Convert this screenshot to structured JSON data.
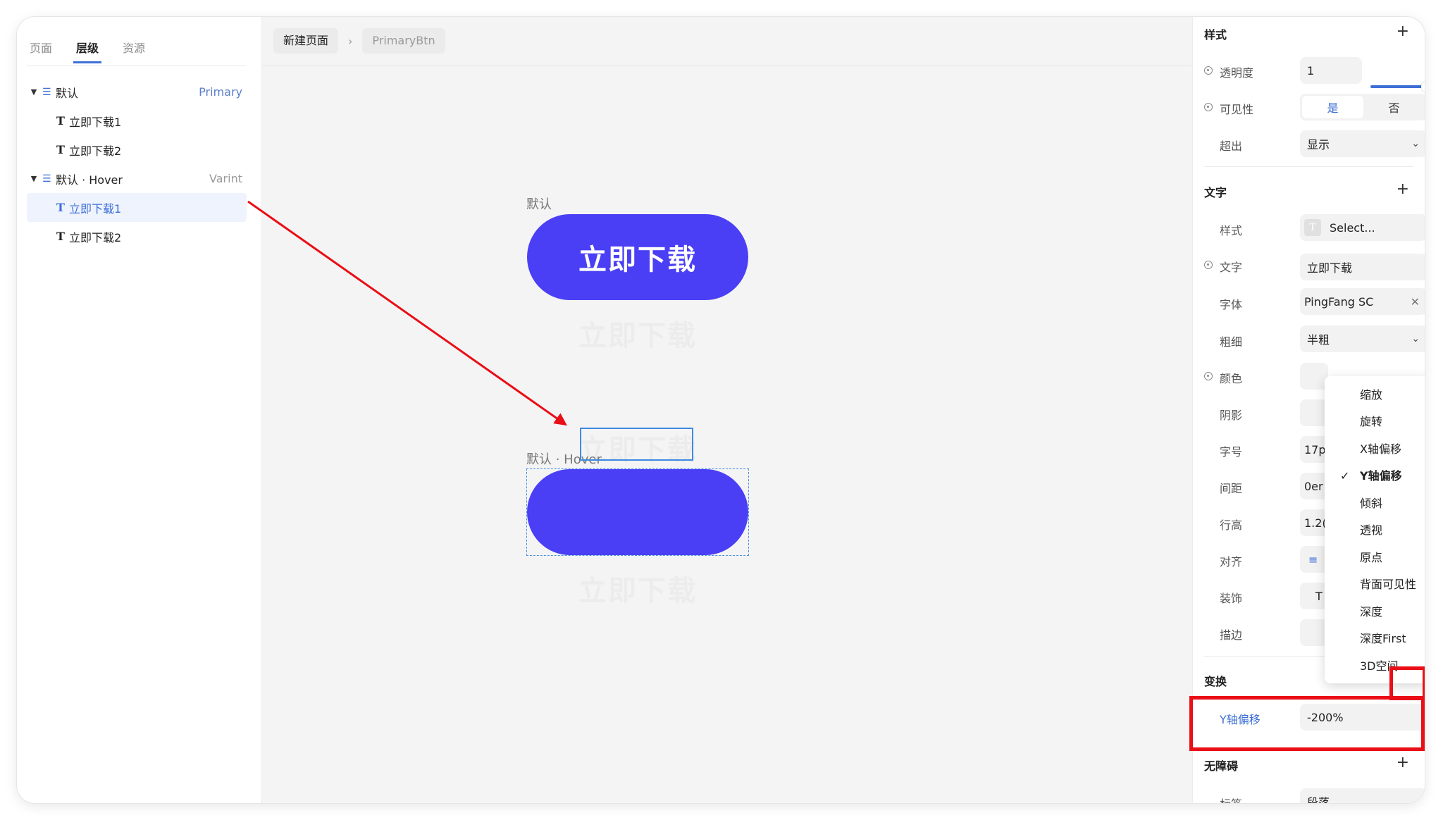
{
  "left_panel": {
    "tabs": [
      {
        "label": "页面"
      },
      {
        "label": "层级"
      },
      {
        "label": "资源"
      }
    ],
    "tree": {
      "group1": {
        "label": "默认",
        "tag": "Primary"
      },
      "g1_child1": "立即下载1",
      "g1_child2": "立即下载2",
      "group2": {
        "label": "默认 · Hover",
        "tag": "Varint"
      },
      "g2_child1": "立即下载1",
      "g2_child2": "立即下载2"
    }
  },
  "canvas": {
    "breadcrumbs": [
      "新建页面",
      "PrimaryBtn"
    ],
    "variant_default_label": "默认",
    "variant_hover_label": "默认 · Hover",
    "button_text": "立即下载",
    "button_color": "#4a3ff5"
  },
  "right_panel": {
    "style": {
      "title": "样式",
      "opacity_label": "透明度",
      "opacity_value": "1",
      "visibility_label": "可见性",
      "visibility_yes": "是",
      "visibility_no": "否",
      "overflow_label": "超出",
      "overflow_value": "显示"
    },
    "text": {
      "title": "文字",
      "style_label": "样式",
      "style_value": "Select...",
      "text_label": "文字",
      "text_value": "立即下载",
      "font_label": "字体",
      "font_value": "PingFang SC",
      "weight_label": "粗细",
      "weight_value": "半粗",
      "color_label": "颜色",
      "shadow_label": "阴影",
      "size_label": "字号",
      "size_value_partial": "17p",
      "spacing_label": "间距",
      "spacing_value_partial": "0er",
      "line_height_label": "行高",
      "line_height_value_partial": "1.2(",
      "align_label": "对齐",
      "decoration_label": "装饰",
      "stroke_label": "描边"
    },
    "transform": {
      "title": "变换",
      "prop_label": "Y轴偏移",
      "prop_value": "-200%"
    },
    "accessibility": {
      "title": "无障碍",
      "partial_label": "标签",
      "partial_value": "段落"
    },
    "transform_menu": {
      "items": [
        "缩放",
        "旋转",
        "X轴偏移",
        "Y轴偏移",
        "倾斜",
        "透视",
        "原点",
        "背面可见性",
        "深度",
        "深度First",
        "3D空间"
      ],
      "checked": "Y轴偏移"
    }
  },
  "colors": {
    "accent": "#3d6fd6",
    "annotation_red": "#ea0e16"
  }
}
